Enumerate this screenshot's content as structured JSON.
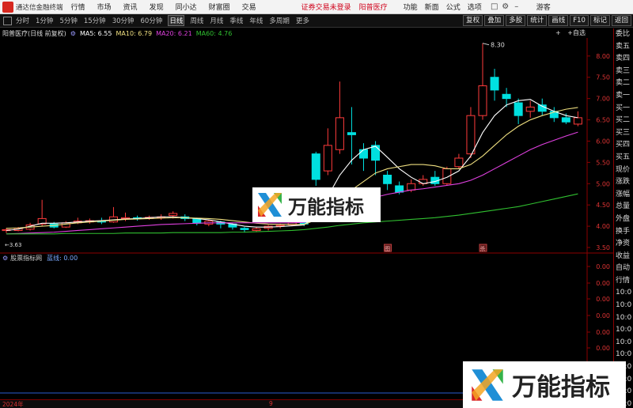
{
  "menubar": {
    "app_title": "通达信金融终端",
    "menus": [
      "行情",
      "市场",
      "资讯",
      "发现",
      "同小达",
      "财富圈",
      "交易"
    ],
    "login_status": "证券交易未登录",
    "stock_name": "阳普医疗",
    "right_menus": [
      "功能",
      "新面",
      "公式",
      "选项"
    ],
    "guest": "游客"
  },
  "periodbar": {
    "periods": [
      "分时",
      "1分钟",
      "5分钟",
      "15分钟",
      "30分钟",
      "60分钟",
      "日线",
      "周线",
      "月线",
      "季线",
      "年线",
      "多周期",
      "更多"
    ],
    "active": "日线",
    "right_buttons": [
      "复权",
      "叠加",
      "多股",
      "统计",
      "画线",
      "F10",
      "标记",
      "返回"
    ]
  },
  "legend": {
    "title": "阳普医疗(日线 前复权)",
    "ma5": "MA5: 6.55",
    "ma10": "MA10: 6.79",
    "ma20": "MA20: 6.21",
    "ma60": "MA60: 4.76",
    "colors": {
      "ma5": "#ffffff",
      "ma10": "#f0e080",
      "ma20": "#e040e0",
      "ma60": "#30c030"
    }
  },
  "checks": {
    "text1": "+",
    "text2": "+自选"
  },
  "price_axis": {
    "ticks": [
      "8.00",
      "7.50",
      "7.00",
      "6.50",
      "6.00",
      "5.50",
      "5.00",
      "4.50",
      "4.00",
      "3.50"
    ],
    "high_label": "8.30",
    "low_label": "3.63"
  },
  "event_tags": [
    "图",
    "杀"
  ],
  "right_panel": [
    "委比",
    "卖五",
    "卖四",
    "卖三",
    "卖二",
    "卖一",
    "买一",
    "买二",
    "买三",
    "买四",
    "买五",
    "现价",
    "涨跌",
    "涨幅",
    "总量",
    "外盘",
    "换手",
    "净资",
    "收益",
    "自动",
    "行情",
    "10:0",
    "10:0",
    "10:0",
    "10:0",
    "10:0",
    "10:0",
    "10:0",
    "10:0",
    "10:0",
    "10:0"
  ],
  "indicator": {
    "name": "股票指标网",
    "value": "蓝线: 0.00",
    "axis_ticks": [
      "0.00",
      "0.00",
      "0.00",
      "0.00",
      "0.00",
      "0.00"
    ]
  },
  "datebar": {
    "year": "2024年",
    "month": "9"
  },
  "watermark": {
    "text": "万能指标"
  },
  "chart_data": {
    "type": "candlestick",
    "ylim": [
      3.5,
      8.35
    ],
    "candles": [
      [
        3.9,
        3.92,
        3.84,
        3.96
      ],
      [
        3.9,
        3.95,
        3.88,
        3.98
      ],
      [
        3.93,
        4.03,
        3.9,
        4.08
      ],
      [
        4.05,
        4.18,
        4.0,
        4.62
      ],
      [
        4.05,
        3.98,
        3.95,
        4.1
      ],
      [
        3.98,
        4.08,
        3.96,
        4.12
      ],
      [
        4.08,
        4.12,
        4.05,
        4.2
      ],
      [
        4.1,
        4.13,
        4.06,
        4.18
      ],
      [
        4.12,
        4.1,
        4.05,
        4.2
      ],
      [
        4.1,
        4.22,
        4.08,
        4.45
      ],
      [
        4.18,
        4.2,
        4.12,
        4.32
      ],
      [
        4.2,
        4.18,
        4.13,
        4.25
      ],
      [
        4.18,
        4.21,
        4.15,
        4.25
      ],
      [
        4.2,
        4.22,
        4.15,
        4.28
      ],
      [
        4.25,
        4.3,
        4.18,
        4.35
      ],
      [
        4.22,
        4.18,
        4.12,
        4.28
      ],
      [
        4.18,
        4.07,
        4.02,
        4.2
      ],
      [
        4.05,
        4.12,
        4.0,
        4.15
      ],
      [
        4.1,
        4.05,
        3.95,
        4.13
      ],
      [
        4.05,
        3.98,
        3.92,
        4.08
      ],
      [
        3.95,
        3.92,
        3.85,
        3.98
      ],
      [
        3.9,
        3.94,
        3.86,
        3.98
      ],
      [
        3.95,
        4.0,
        3.9,
        4.03
      ],
      [
        4.0,
        4.02,
        3.95,
        4.06
      ],
      [
        4.03,
        4.08,
        4.0,
        4.12
      ],
      [
        4.1,
        4.05,
        4.0,
        4.14
      ],
      [
        5.7,
        5.1,
        4.95,
        5.75
      ],
      [
        5.3,
        5.9,
        5.2,
        6.3
      ],
      [
        5.8,
        6.55,
        5.7,
        7.4
      ],
      [
        6.2,
        6.15,
        5.45,
        6.8
      ],
      [
        5.8,
        5.6,
        5.3,
        5.95
      ],
      [
        5.9,
        5.55,
        5.2,
        6.0
      ],
      [
        5.2,
        5.0,
        4.85,
        5.3
      ],
      [
        4.95,
        4.8,
        4.75,
        5.05
      ],
      [
        4.85,
        5.0,
        4.8,
        5.1
      ],
      [
        5.0,
        5.1,
        4.95,
        5.2
      ],
      [
        5.15,
        5.0,
        4.95,
        5.3
      ],
      [
        5.0,
        5.35,
        4.95,
        5.4
      ],
      [
        5.4,
        5.6,
        5.35,
        5.7
      ],
      [
        5.7,
        6.6,
        5.6,
        6.8
      ],
      [
        6.6,
        7.3,
        6.5,
        8.3
      ],
      [
        7.5,
        7.2,
        6.95,
        7.7
      ],
      [
        7.1,
        7.0,
        6.8,
        7.25
      ],
      [
        6.9,
        6.6,
        6.4,
        7.0
      ],
      [
        6.7,
        6.8,
        6.55,
        6.95
      ],
      [
        6.85,
        6.7,
        6.6,
        7.0
      ],
      [
        6.7,
        6.55,
        6.45,
        6.8
      ],
      [
        6.55,
        6.45,
        6.4,
        6.65
      ],
      [
        6.4,
        6.55,
        6.35,
        6.7
      ]
    ],
    "ma": {
      "ma5": [
        3.9,
        3.93,
        4.0,
        4.07,
        4.07,
        4.08,
        4.1,
        4.12,
        4.13,
        4.15,
        4.17,
        4.18,
        4.2,
        4.22,
        4.22,
        4.2,
        4.18,
        4.15,
        4.1,
        4.05,
        4.0,
        3.98,
        3.98,
        3.99,
        4.01,
        4.03,
        4.25,
        4.7,
        5.2,
        5.55,
        5.8,
        5.88,
        5.62,
        5.35,
        5.15,
        5.0,
        5.05,
        5.15,
        5.3,
        5.65,
        6.2,
        6.6,
        6.85,
        6.95,
        6.98,
        6.82,
        6.7,
        6.6,
        6.55
      ],
      "ma10": [
        3.95,
        3.96,
        3.98,
        4.0,
        4.02,
        4.05,
        4.08,
        4.1,
        4.12,
        4.14,
        4.16,
        4.17,
        4.18,
        4.19,
        4.2,
        4.2,
        4.19,
        4.18,
        4.16,
        4.13,
        4.1,
        4.07,
        4.05,
        4.04,
        4.04,
        4.04,
        4.15,
        4.35,
        4.6,
        4.85,
        5.05,
        5.25,
        5.35,
        5.4,
        5.45,
        5.45,
        5.42,
        5.35,
        5.35,
        5.45,
        5.65,
        5.9,
        6.15,
        6.35,
        6.5,
        6.6,
        6.68,
        6.75,
        6.79
      ],
      "ma20": [
        3.82,
        3.83,
        3.84,
        3.85,
        3.86,
        3.88,
        3.9,
        3.92,
        3.94,
        3.96,
        3.98,
        4.0,
        4.02,
        4.04,
        4.05,
        4.06,
        4.07,
        4.08,
        4.08,
        4.08,
        4.08,
        4.08,
        4.08,
        4.08,
        4.08,
        4.09,
        4.15,
        4.22,
        4.32,
        4.45,
        4.58,
        4.68,
        4.75,
        4.8,
        4.85,
        4.88,
        4.92,
        4.96,
        5.0,
        5.08,
        5.2,
        5.35,
        5.5,
        5.65,
        5.8,
        5.92,
        6.02,
        6.12,
        6.21
      ],
      "ma60": [
        3.82,
        3.82,
        3.82,
        3.82,
        3.82,
        3.83,
        3.83,
        3.83,
        3.83,
        3.83,
        3.84,
        3.84,
        3.84,
        3.84,
        3.85,
        3.85,
        3.85,
        3.85,
        3.85,
        3.86,
        3.86,
        3.87,
        3.88,
        3.89,
        3.9,
        3.92,
        3.95,
        3.98,
        4.02,
        4.05,
        4.08,
        4.1,
        4.12,
        4.14,
        4.16,
        4.18,
        4.2,
        4.23,
        4.26,
        4.3,
        4.34,
        4.38,
        4.42,
        4.46,
        4.52,
        4.58,
        4.64,
        4.7,
        4.76
      ]
    },
    "up_color": "#ff3b3b",
    "down_color": "#00e0e0"
  }
}
